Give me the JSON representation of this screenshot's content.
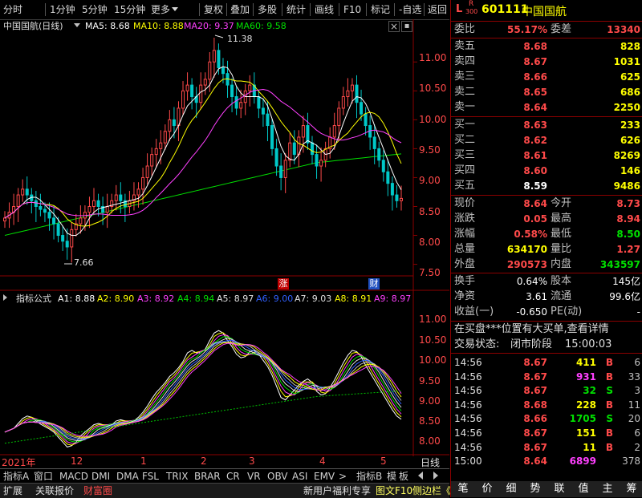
{
  "toolbar": {
    "left_items": [
      "分时",
      "1分钟",
      "5分钟",
      "15分钟",
      "更多"
    ],
    "right_items": [
      "复权",
      "叠加",
      "多股",
      "统计",
      "画线",
      "F10",
      "标记",
      "-自选",
      "返回"
    ]
  },
  "main_legend": {
    "title": "中国国航(日线)",
    "ma5": "MA5: 8.68",
    "ma10": "MA10: 8.88",
    "ma20": "MA20: 9.37",
    "ma60": "MA60: 9.58"
  },
  "price_axis": [
    "11.00",
    "10.50",
    "10.00",
    "9.50",
    "9.00",
    "8.50",
    "8.00",
    "7.50"
  ],
  "annotations": {
    "high": "11.38",
    "low": "7.66",
    "zhang": "涨",
    "cai": "财"
  },
  "indicator_legend": {
    "name": "指标公式",
    "a1": "A1: 8.88",
    "a2": "A2: 8.90",
    "a3": "A3: 8.92",
    "a4": "A4: 8.94",
    "a5": "A5: 8.97",
    "a6": "A6: 9.00",
    "a7": "A7: 9.03",
    "a8": "A8: 8.91",
    "a9": "A9: 8.97"
  },
  "indicator_axis": [
    "11.00",
    "10.50",
    "10.00",
    "9.50",
    "9.00",
    "8.50",
    "8.00"
  ],
  "time_axis": {
    "labels": [
      "2021年",
      "12",
      "1",
      "2",
      "3",
      "4",
      "5"
    ],
    "period": "日线"
  },
  "bottom_tabs": [
    "指标A",
    "窗口",
    "MACD",
    "DMI",
    "DMA",
    "FSL",
    "TRIX",
    "BRAR",
    "CR",
    "VR",
    "OBV",
    "ASI",
    "EMV",
    ">",
    "指标B",
    "模",
    "板"
  ],
  "bottom_bar": {
    "items": [
      "扩展",
      "关联报价",
      "财富圈"
    ],
    "promo": "新用户福利专享",
    "f10": "图文F10",
    "sidebar": "侧边栏《"
  },
  "panel": {
    "header": {
      "l": "L",
      "r": "R",
      "r_sub": "300",
      "code": "601111",
      "name": "中国国航"
    },
    "weibi": {
      "label": "委比",
      "value": "55.17%",
      "label2": "委差",
      "value2": "13340"
    },
    "sells": [
      {
        "label": "卖五",
        "price": "8.68",
        "vol": "828"
      },
      {
        "label": "卖四",
        "price": "8.67",
        "vol": "1031"
      },
      {
        "label": "卖三",
        "price": "8.66",
        "vol": "625"
      },
      {
        "label": "卖二",
        "price": "8.65",
        "vol": "686"
      },
      {
        "label": "卖一",
        "price": "8.64",
        "vol": "2250"
      }
    ],
    "buys": [
      {
        "label": "买一",
        "price": "8.63",
        "vol": "233"
      },
      {
        "label": "买二",
        "price": "8.62",
        "vol": "626"
      },
      {
        "label": "买三",
        "price": "8.61",
        "vol": "8269"
      },
      {
        "label": "买四",
        "price": "8.60",
        "vol": "146"
      },
      {
        "label": "买五",
        "price": "8.59",
        "vol": "9486"
      }
    ],
    "quote": [
      {
        "l1": "现价",
        "v1": "8.64",
        "l2": "今开",
        "v2": "8.73"
      },
      {
        "l1": "涨跌",
        "v1": "0.05",
        "l2": "最高",
        "v2": "8.94"
      },
      {
        "l1": "涨幅",
        "v1": "0.58%",
        "l2": "最低",
        "v2": "8.50"
      },
      {
        "l1": "总量",
        "v1": "634170",
        "l2": "量比",
        "v2": "1.27"
      },
      {
        "l1": "外盘",
        "v1": "290573",
        "l2": "内盘",
        "v2": "343597"
      }
    ],
    "fund": [
      {
        "l1": "换手",
        "v1": "0.64%",
        "l2": "股本",
        "v2": "145亿"
      },
      {
        "l1": "净资",
        "v1": "3.61",
        "l2": "流通",
        "v2": "99.6亿"
      },
      {
        "l1": "收益(一)",
        "v1": "-0.650",
        "l2": "PE(动)",
        "v2": "-"
      }
    ],
    "notice": "在买盘***位置有大买单,查看详情",
    "status": {
      "label": "交易状态:",
      "value": "闭市阶段",
      "time": "15:00:03"
    },
    "ticks": [
      {
        "time": "14:56",
        "price": "8.67",
        "vol": "411",
        "bs": "B",
        "n": "6"
      },
      {
        "time": "14:56",
        "price": "8.67",
        "vol": "931",
        "bs": "B",
        "n": "33"
      },
      {
        "time": "14:56",
        "price": "8.67",
        "vol": "32",
        "bs": "S",
        "n": "3"
      },
      {
        "time": "14:56",
        "price": "8.68",
        "vol": "228",
        "bs": "B",
        "n": "11"
      },
      {
        "time": "14:56",
        "price": "8.66",
        "vol": "1705",
        "bs": "S",
        "n": "20"
      },
      {
        "time": "14:56",
        "price": "8.67",
        "vol": "151",
        "bs": "B",
        "n": "6"
      },
      {
        "time": "14:56",
        "price": "8.67",
        "vol": "11",
        "bs": "B",
        "n": "2"
      },
      {
        "time": "15:00",
        "price": "8.64",
        "vol": "6899",
        "bs": "",
        "n": "378"
      }
    ],
    "nav": [
      "笔",
      "价",
      "细",
      "势",
      "联",
      "值",
      "主",
      "筹"
    ]
  },
  "chart_data": {
    "type": "candlestick",
    "ylim": [
      7.3,
      11.6
    ],
    "highest": 11.38,
    "lowest": 7.66,
    "ma5_last": 8.68,
    "ma10_last": 8.88,
    "ma20_last": 9.37,
    "ma60_last": 9.58,
    "close_series": [
      8.3,
      8.4,
      8.5,
      8.7,
      8.8,
      8.7,
      8.6,
      8.5,
      8.45,
      8.4,
      8.3,
      8.2,
      8.0,
      7.9,
      7.8,
      8.1,
      8.2,
      8.3,
      8.4,
      8.5,
      8.6,
      8.5,
      8.4,
      8.5,
      8.6,
      8.7,
      8.6,
      8.5,
      8.6,
      8.7,
      8.8,
      9.0,
      9.2,
      9.4,
      9.5,
      9.6,
      9.8,
      10.0,
      9.9,
      10.2,
      10.5,
      10.6,
      10.4,
      10.3,
      10.6,
      10.7,
      11.0,
      11.2,
      10.9,
      10.8,
      10.6,
      10.4,
      10.2,
      10.3,
      10.5,
      10.6,
      10.4,
      10.2,
      10.1,
      9.9,
      9.5,
      9.2,
      9.0,
      9.3,
      9.6,
      9.4,
      9.7,
      9.9,
      9.6,
      9.4,
      9.2,
      9.3,
      9.5,
      9.7,
      9.9,
      10.2,
      10.4,
      10.5,
      10.6,
      10.3,
      10.1,
      9.9,
      9.7,
      9.5,
      9.3,
      9.1,
      8.9,
      8.7,
      8.6,
      8.64
    ]
  }
}
